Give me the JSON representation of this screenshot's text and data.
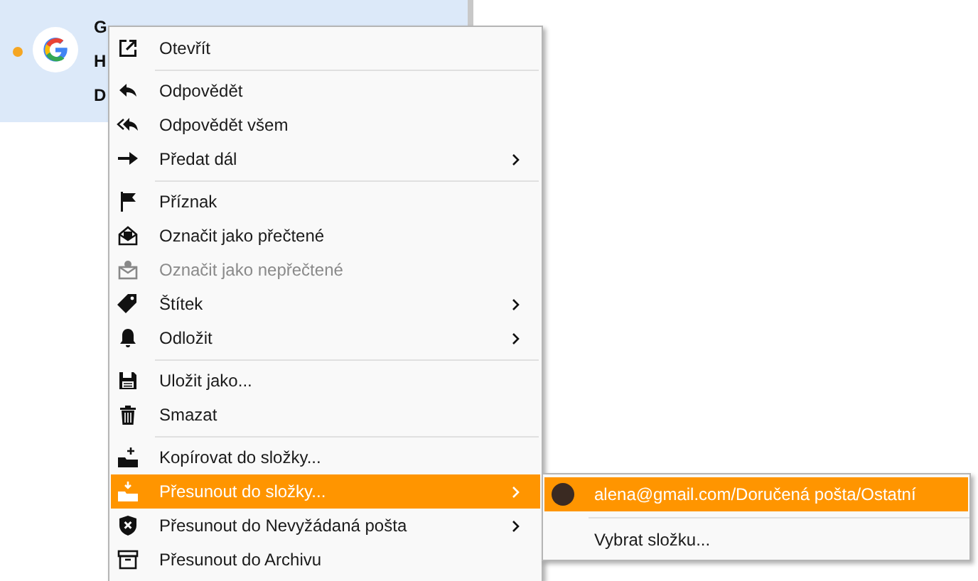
{
  "message": {
    "unread": true,
    "lines": [
      "G",
      "H",
      "D"
    ],
    "selected": true
  },
  "context_menu": {
    "groups": [
      [
        {
          "label": "Otevřít",
          "submenu": false,
          "disabled": false,
          "selected": false
        }
      ],
      [
        {
          "label": "Odpovědět",
          "submenu": false,
          "disabled": false,
          "selected": false
        },
        {
          "label": "Odpovědět všem",
          "submenu": false,
          "disabled": false,
          "selected": false
        },
        {
          "label": "Předat dál",
          "submenu": true,
          "disabled": false,
          "selected": false
        }
      ],
      [
        {
          "label": "Příznak",
          "submenu": false,
          "disabled": false,
          "selected": false
        },
        {
          "label": "Označit jako přečtené",
          "submenu": false,
          "disabled": false,
          "selected": false
        },
        {
          "label": "Označit jako nepřečtené",
          "submenu": false,
          "disabled": true,
          "selected": false
        },
        {
          "label": "Štítek",
          "submenu": true,
          "disabled": false,
          "selected": false
        },
        {
          "label": "Odložit",
          "submenu": true,
          "disabled": false,
          "selected": false
        }
      ],
      [
        {
          "label": "Uložit jako...",
          "submenu": false,
          "disabled": false,
          "selected": false
        },
        {
          "label": "Smazat",
          "submenu": false,
          "disabled": false,
          "selected": false
        }
      ],
      [
        {
          "label": "Kopírovat do složky...",
          "submenu": false,
          "disabled": false,
          "selected": false
        },
        {
          "label": "Přesunout do složky...",
          "submenu": true,
          "disabled": false,
          "selected": true
        },
        {
          "label": "Přesunout do Nevyžádaná pošta",
          "submenu": true,
          "disabled": false,
          "selected": false
        },
        {
          "label": "Přesunout do Archivu",
          "submenu": false,
          "disabled": false,
          "selected": false
        }
      ]
    ]
  },
  "submenu": {
    "items": [
      {
        "kind": "account",
        "label": "alena@gmail.com/Doručená pošta/Ostatní",
        "selected": true
      },
      {
        "kind": "separator"
      },
      {
        "kind": "plain",
        "label": "Vybrat složku...",
        "selected": false
      }
    ]
  }
}
